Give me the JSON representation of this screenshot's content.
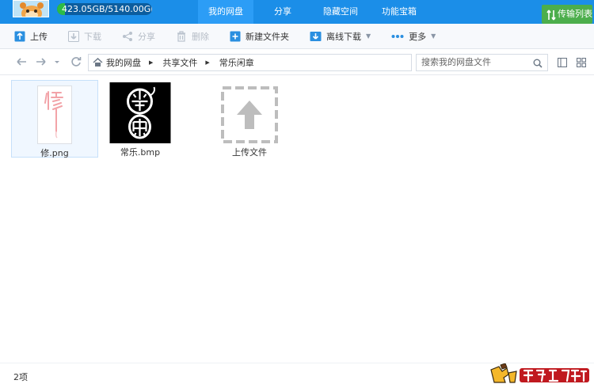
{
  "topbar": {
    "quota_text": "423.05GB/5140.00GB",
    "quota_used_fraction": 0.082,
    "tabs": [
      {
        "label": "我的网盘",
        "active": true
      },
      {
        "label": "分享",
        "active": false
      },
      {
        "label": "隐藏空间",
        "active": false
      },
      {
        "label": "功能宝箱",
        "active": false
      }
    ],
    "transfer_label": "传输列表"
  },
  "toolbar": {
    "upload": "上传",
    "download": "下载",
    "share": "分享",
    "delete": "删除",
    "new_folder": "新建文件夹",
    "offline_download": "离线下载",
    "more": "更多"
  },
  "address": {
    "crumbs": [
      "我的网盘",
      "共享文件",
      "常乐闲章"
    ],
    "search_placeholder": "搜索我的网盘文件"
  },
  "files": [
    {
      "name": "修.png",
      "icon": "png-thumbnail-icon",
      "selected": true
    },
    {
      "name": "常乐.bmp",
      "icon": "bmp-seal-thumbnail-icon",
      "selected": false
    },
    {
      "name": "上传文件",
      "icon": "upload-placeholder-icon",
      "selected": false
    }
  ],
  "status": {
    "item_count": "2项"
  },
  "colors": {
    "topbar_blue": "#1b8ee8",
    "active_tab": "#2c9df6",
    "quota_green": "#2dbb46",
    "transfer_green": "#4cae4c"
  }
}
